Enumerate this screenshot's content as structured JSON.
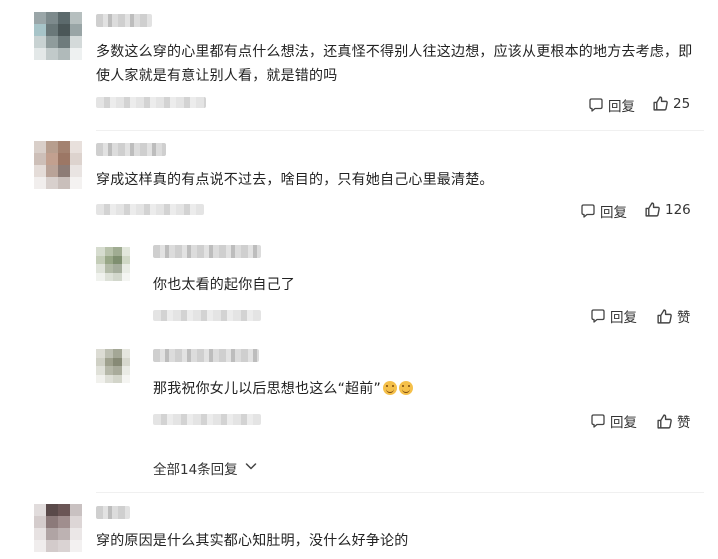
{
  "comments": [
    {
      "text_line1": "多数这么穿的心里都有点什么想法，还真怪不得别人往这边想，应该从更根本的地方去考虑，即",
      "text_line2": "使人家就是有意让别人看，就是错的吗",
      "reply_label": "回复",
      "like_count": "25"
    },
    {
      "text_line1": "穿成这样真的有点说不过去，啥目的，只有她自己心里最清楚。",
      "reply_label": "回复",
      "like_count": "126",
      "replies": [
        {
          "text": "你也太看的起你自己了",
          "reply_label": "回复",
          "like_label": "赞"
        },
        {
          "text": "那我祝你女儿以后思想也这么“超前”",
          "reply_label": "回复",
          "like_label": "赞"
        }
      ],
      "expand_label": "全部14条回复"
    },
    {
      "text_line1": "穿的原因是什么其实都心知肚明，没什么好争论的"
    }
  ],
  "icons": {
    "reply": "comment-bubble-icon",
    "like": "thumbs-up-icon",
    "expand": "chevron-down-icon"
  },
  "colors": {
    "text": "#222222",
    "action": "#333333",
    "emoji": "#f5c04a"
  }
}
